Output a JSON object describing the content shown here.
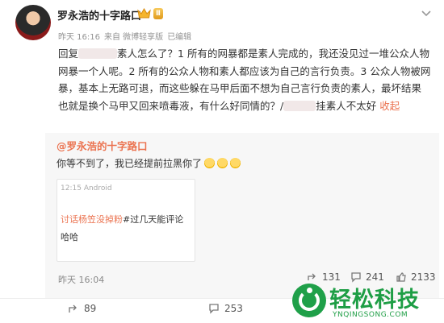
{
  "post": {
    "username": "罗永浩的十字路口",
    "level_badge": "Ⅱ",
    "time": "昨天 16:16",
    "source": "来自 微博轻享版",
    "edited": "已编辑",
    "text_part1": "回复",
    "text_part2": "素人怎么了？1 所有的网暴都是素人完成的，我还没见过一堆公众人物网暴一个人呢。2 所有的公众人物和素人都应该为自己的言行负责。3 公众人物被网暴，基本上无路可退，而这些躲在马甲后面",
    "text_part3": "不想为自己言行负责的素人，最坏结果也就是换个马甲又回来喷毒液，有什么好同情的？",
    "text_part4": "/",
    "text_part5": "挂素人不太好",
    "collapse_label": "收起",
    "likes_label": ""
  },
  "repost": {
    "user": "@罗永浩的十字路口",
    "text": "你等不到了，我已经提前拉黑你了",
    "card": {
      "time": "12:15",
      "app": "Android",
      "link_text": "讨话杨笠没掉粉",
      "rest_text": "#过几天能评论",
      "line2": "哈哈"
    },
    "time": "昨天 16:04",
    "share_count": "131",
    "comment_count": "241",
    "like_count": "2133"
  },
  "footer": {
    "share_count": "89",
    "comment_count": "253",
    "like_count": ""
  },
  "watermark": {
    "title": "轻松科技",
    "url": "YNQINGSONG.COM"
  },
  "colors": {
    "accent": "#eb7350",
    "watermark_green": "#1e9e45"
  },
  "icons": [
    "more-icon",
    "crown-icon",
    "share-icon",
    "comment-icon",
    "like-icon",
    "emoji-icon"
  ]
}
